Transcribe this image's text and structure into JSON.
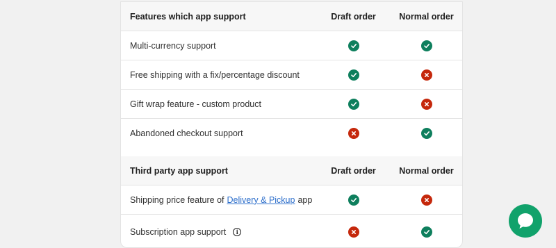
{
  "colors": {
    "yes": "#0e7f5d",
    "no": "#c5280c",
    "chat": "#11a26b",
    "link": "#2c6ecb"
  },
  "section1": {
    "header": {
      "feature": "Features which app support",
      "col1": "Draft order",
      "col2": "Normal order"
    },
    "rows": [
      {
        "feature": "Multi-currency support",
        "draft": "check-icon",
        "normal": "check-icon"
      },
      {
        "feature": "Free shipping with a fix/percentage discount",
        "draft": "check-icon",
        "normal": "cross-icon"
      },
      {
        "feature": "Gift wrap feature - custom product",
        "draft": "check-icon",
        "normal": "cross-icon"
      },
      {
        "feature": "Abandoned checkout support",
        "draft": "cross-icon",
        "normal": "check-icon"
      }
    ]
  },
  "section2": {
    "header": {
      "feature": "Third party app support",
      "col1": "Draft order",
      "col2": "Normal order"
    },
    "rows": [
      {
        "prefix": "Shipping price feature of",
        "link": "Delivery & Pickup",
        "suffix": "app",
        "draft": "check-icon",
        "normal": "cross-icon"
      },
      {
        "feature": "Subscription app support",
        "info_icon": "info-icon",
        "draft": "cross-icon",
        "normal": "check-icon"
      }
    ]
  },
  "chat_button": {
    "icon": "chat-bubble-icon"
  }
}
